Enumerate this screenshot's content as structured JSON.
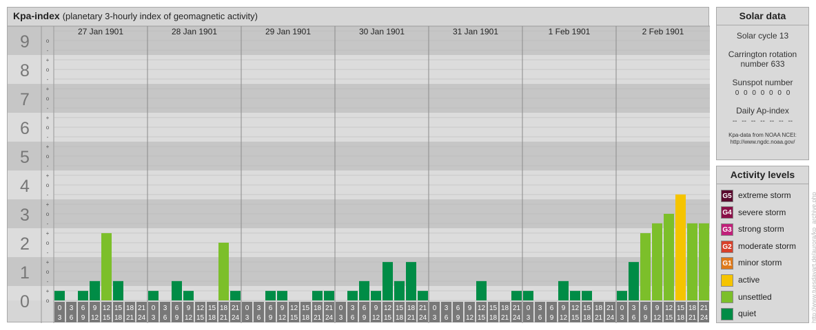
{
  "title": "Kpa-index",
  "subtitle": "(planetary 3-hourly index of geomagnetic activity)",
  "chart_data": {
    "type": "bar",
    "title": "Kpa-index",
    "subtitle": "(planetary 3-hourly index of geomagnetic activity)",
    "y_tick_labels": [
      "0",
      "1",
      "2",
      "3",
      "4",
      "5",
      "6",
      "7",
      "8",
      "9"
    ],
    "y_minor_labels": [
      "o",
      "+",
      "-",
      "o"
    ],
    "ylim": [
      0,
      9.33
    ],
    "days": [
      "27 Jan 1901",
      "28 Jan 1901",
      "29 Jan 1901",
      "30 Jan 1901",
      "31 Jan 1901",
      "1 Feb 1901",
      "2 Feb 1901"
    ],
    "interval_labels_top": [
      "0",
      "3",
      "6",
      "9",
      "12",
      "15",
      "18",
      "21"
    ],
    "interval_labels_bottom": [
      "3",
      "6",
      "9",
      "12",
      "15",
      "18",
      "21",
      "24"
    ],
    "values": [
      [
        0.33,
        0,
        0.33,
        0.67,
        2.33,
        0.67,
        0,
        0
      ],
      [
        0.33,
        0,
        0.67,
        0.33,
        0,
        0,
        2,
        0.33
      ],
      [
        0,
        0,
        0.33,
        0.33,
        0,
        0,
        0.33,
        0.33
      ],
      [
        0,
        0.33,
        0.67,
        0.33,
        1.33,
        0.67,
        1.33,
        0.33
      ],
      [
        0,
        0,
        0,
        0,
        0.67,
        0,
        0,
        0.33
      ],
      [
        0.33,
        0,
        0,
        0.67,
        0.33,
        0.33,
        0,
        0
      ],
      [
        0.33,
        1.33,
        2.33,
        2.67,
        3,
        3.67,
        2.67,
        2.67
      ]
    ],
    "level_colors": {
      "quiet": "#008c46",
      "unsettled": "#7cbf2a",
      "active": "#f5c400"
    }
  },
  "solar": {
    "title": "Solar data",
    "cycle": "Solar cycle 13",
    "carrington_1": "Carrington rotation",
    "carrington_2": "number 633",
    "sunspot_title": "Sunspot number",
    "sunspot_values": "0 0 0 0 0 0 0",
    "ap_title": "Daily Ap-index",
    "ap_values": "-- -- -- -- -- -- --",
    "credit_1": "Kpa-data from NOAA NCEI:",
    "credit_2": "http://www.ngdc.noaa.gov/"
  },
  "levels": {
    "title": "Activity levels",
    "items": [
      {
        "code": "G5",
        "label": "extreme storm",
        "color": "#5a0a2e"
      },
      {
        "code": "G4",
        "label": "severe storm",
        "color": "#8a1048"
      },
      {
        "code": "G3",
        "label": "strong storm",
        "color": "#c0207a"
      },
      {
        "code": "G2",
        "label": "moderate storm",
        "color": "#d8402a"
      },
      {
        "code": "G1",
        "label": "minor storm",
        "color": "#e07a1a"
      },
      {
        "code": "",
        "label": "active",
        "color": "#f5c400"
      },
      {
        "code": "",
        "label": "unsettled",
        "color": "#7cbf2a"
      },
      {
        "code": "",
        "label": "quiet",
        "color": "#008c46"
      }
    ]
  },
  "watermark": "http://www.tuesdayart.de/aurora/kp_archive.php"
}
